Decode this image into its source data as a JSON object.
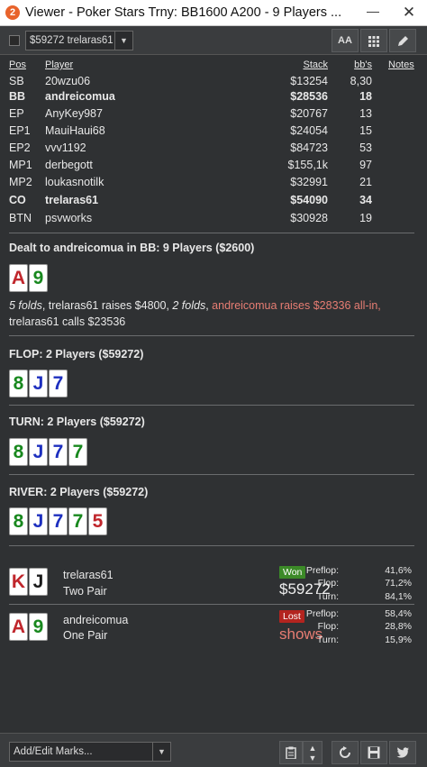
{
  "window": {
    "title": "Viewer - Poker Stars Trny: BB1600 A200 - 9 Players ...",
    "app_icon": "2",
    "minimize": "—",
    "close": "✕"
  },
  "toolbar": {
    "hand_select": "$59272 trelaras61",
    "font_btn": "AA"
  },
  "table": {
    "headers": {
      "pos": "Pos",
      "player": "Player",
      "stack": "Stack",
      "bbs": "bb's",
      "notes": "Notes"
    },
    "rows": [
      {
        "pos": "SB",
        "player": "20wzu06",
        "stack": "$13254",
        "bbs": "8,30"
      },
      {
        "pos": "BB",
        "player": "andreicomua",
        "stack": "$28536",
        "bbs": "18"
      },
      {
        "pos": "EP",
        "player": "AnyKey987",
        "stack": "$20767",
        "bbs": "13"
      },
      {
        "pos": "EP1",
        "player": "MauiHaui68",
        "stack": "$24054",
        "bbs": "15"
      },
      {
        "pos": "EP2",
        "player": "vvv1192",
        "stack": "$84723",
        "bbs": "53"
      },
      {
        "pos": "MP1",
        "player": "derbegott",
        "stack": "$155,1k",
        "bbs": "97"
      },
      {
        "pos": "MP2",
        "player": "loukasnotilk",
        "stack": "$32991",
        "bbs": "21"
      },
      {
        "pos": "CO",
        "player": "trelaras61",
        "stack": "$54090",
        "bbs": "34"
      },
      {
        "pos": "BTN",
        "player": "psvworks",
        "stack": "$30928",
        "bbs": "19"
      }
    ]
  },
  "preflop": {
    "title": "Dealt to andreicomua in BB: 9 Players ($2600)",
    "cards": [
      {
        "rank": "A",
        "suit": "h"
      },
      {
        "rank": "9",
        "suit": "c"
      }
    ],
    "a1": "5 folds",
    "a2": ", trelaras61 raises $4800, ",
    "a3": "2 folds",
    "a4": ", ",
    "a5": "andreicomua raises $28336 all-in,",
    "a6": "trelaras61 calls $23536"
  },
  "flop": {
    "title": "FLOP: 2 Players ($59272)",
    "cards": [
      {
        "rank": "8",
        "suit": "c"
      },
      {
        "rank": "J",
        "suit": "d"
      },
      {
        "rank": "7",
        "suit": "d"
      }
    ]
  },
  "turn": {
    "title": "TURN: 2 Players ($59272)",
    "cards": [
      {
        "rank": "8",
        "suit": "c"
      },
      {
        "rank": "J",
        "suit": "d"
      },
      {
        "rank": "7",
        "suit": "d"
      },
      {
        "rank": "7",
        "suit": "c"
      }
    ]
  },
  "river": {
    "title": "RIVER: 2 Players ($59272)",
    "cards": [
      {
        "rank": "8",
        "suit": "c"
      },
      {
        "rank": "J",
        "suit": "d"
      },
      {
        "rank": "7",
        "suit": "d"
      },
      {
        "rank": "7",
        "suit": "c"
      },
      {
        "rank": "5",
        "suit": "h"
      }
    ]
  },
  "results": [
    {
      "name": "trelaras61",
      "hand": "Two Pair",
      "badge": "Won",
      "amount": "$59272",
      "cards": [
        {
          "rank": "K",
          "suit": "h"
        },
        {
          "rank": "J",
          "suit": "s"
        }
      ],
      "pre_lbl": "Preflop:",
      "pre": "41,6%",
      "flop_lbl": "Flop:",
      "flop": "71,2%",
      "turn_lbl": "Turn:",
      "turn": "84,1%"
    },
    {
      "name": "andreicomua",
      "hand": "One Pair",
      "badge": "Lost",
      "amount": "shows",
      "cards": [
        {
          "rank": "A",
          "suit": "h"
        },
        {
          "rank": "9",
          "suit": "c"
        }
      ],
      "pre_lbl": "Preflop:",
      "pre": "58,4%",
      "flop_lbl": "Flop:",
      "flop": "28,8%",
      "turn_lbl": "Turn:",
      "turn": "15,9%"
    }
  ],
  "bottom": {
    "marks_placeholder": "Add/Edit Marks..."
  },
  "colors": {
    "won": "#3c8a28",
    "lost": "#b3241f",
    "highlight_red": "#e77d73"
  }
}
